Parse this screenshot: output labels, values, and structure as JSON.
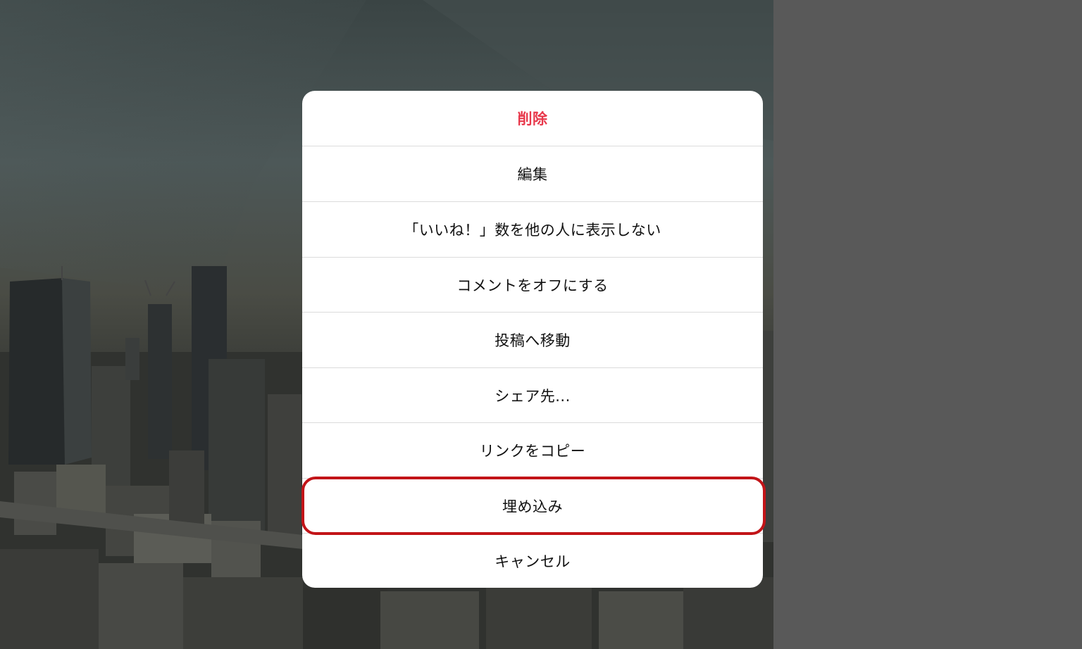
{
  "menu": {
    "items": [
      {
        "label": "削除",
        "style": "danger"
      },
      {
        "label": "編集",
        "style": "normal"
      },
      {
        "label": "「いいね！」数を他の人に表示しない",
        "style": "normal"
      },
      {
        "label": "コメントをオフにする",
        "style": "normal"
      },
      {
        "label": "投稿へ移動",
        "style": "normal"
      },
      {
        "label": "シェア先...",
        "style": "normal"
      },
      {
        "label": "リンクをコピー",
        "style": "normal"
      },
      {
        "label": "埋め込み",
        "style": "normal",
        "highlighted": true
      },
      {
        "label": "キャンセル",
        "style": "normal"
      }
    ]
  },
  "colors": {
    "danger": "#e8384b",
    "highlight_border": "#c21418",
    "overlay": "#585858"
  }
}
